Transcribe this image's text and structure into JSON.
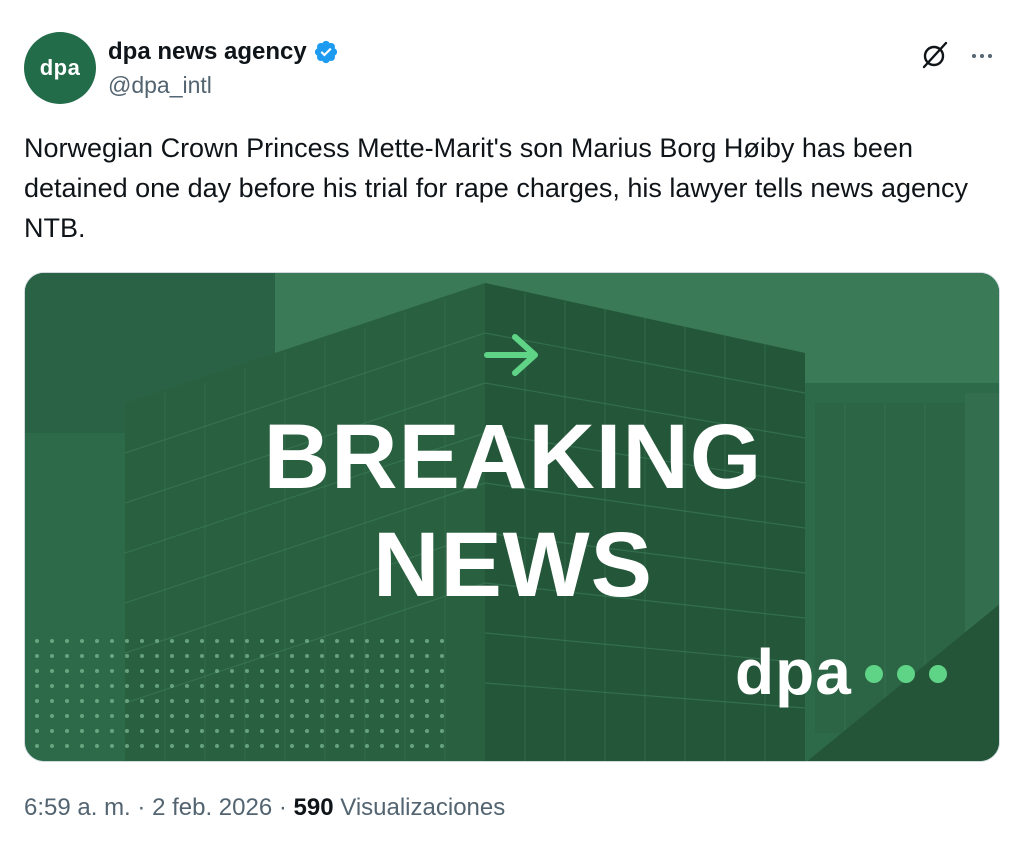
{
  "account": {
    "avatar_text": "dpa",
    "display_name": "dpa news agency",
    "handle": "@dpa_intl",
    "verified": true
  },
  "tweet": {
    "text": "Norwegian Crown Princess Mette-Marit's son Marius Borg Høiby has been detained one day before his trial for rape charges, his lawyer tells news agency NTB."
  },
  "media": {
    "headline_line1": "BREAKING",
    "headline_line2": "NEWS",
    "logo_text": "dpa",
    "accent_color": "#5fd486",
    "overlay_color": "#2f6c4b"
  },
  "meta": {
    "time": "6:59 a. m.",
    "separator": "·",
    "date": "2 feb. 2026",
    "views_count": "590",
    "views_label": "Visualizaciones"
  },
  "icons": [
    "verified-badge-icon",
    "grok-icon",
    "more-icon",
    "arrow-right-icon"
  ],
  "colors": {
    "brand_green": "#236c4a",
    "verified_blue": "#1d9bf0",
    "secondary_text": "#536471"
  }
}
